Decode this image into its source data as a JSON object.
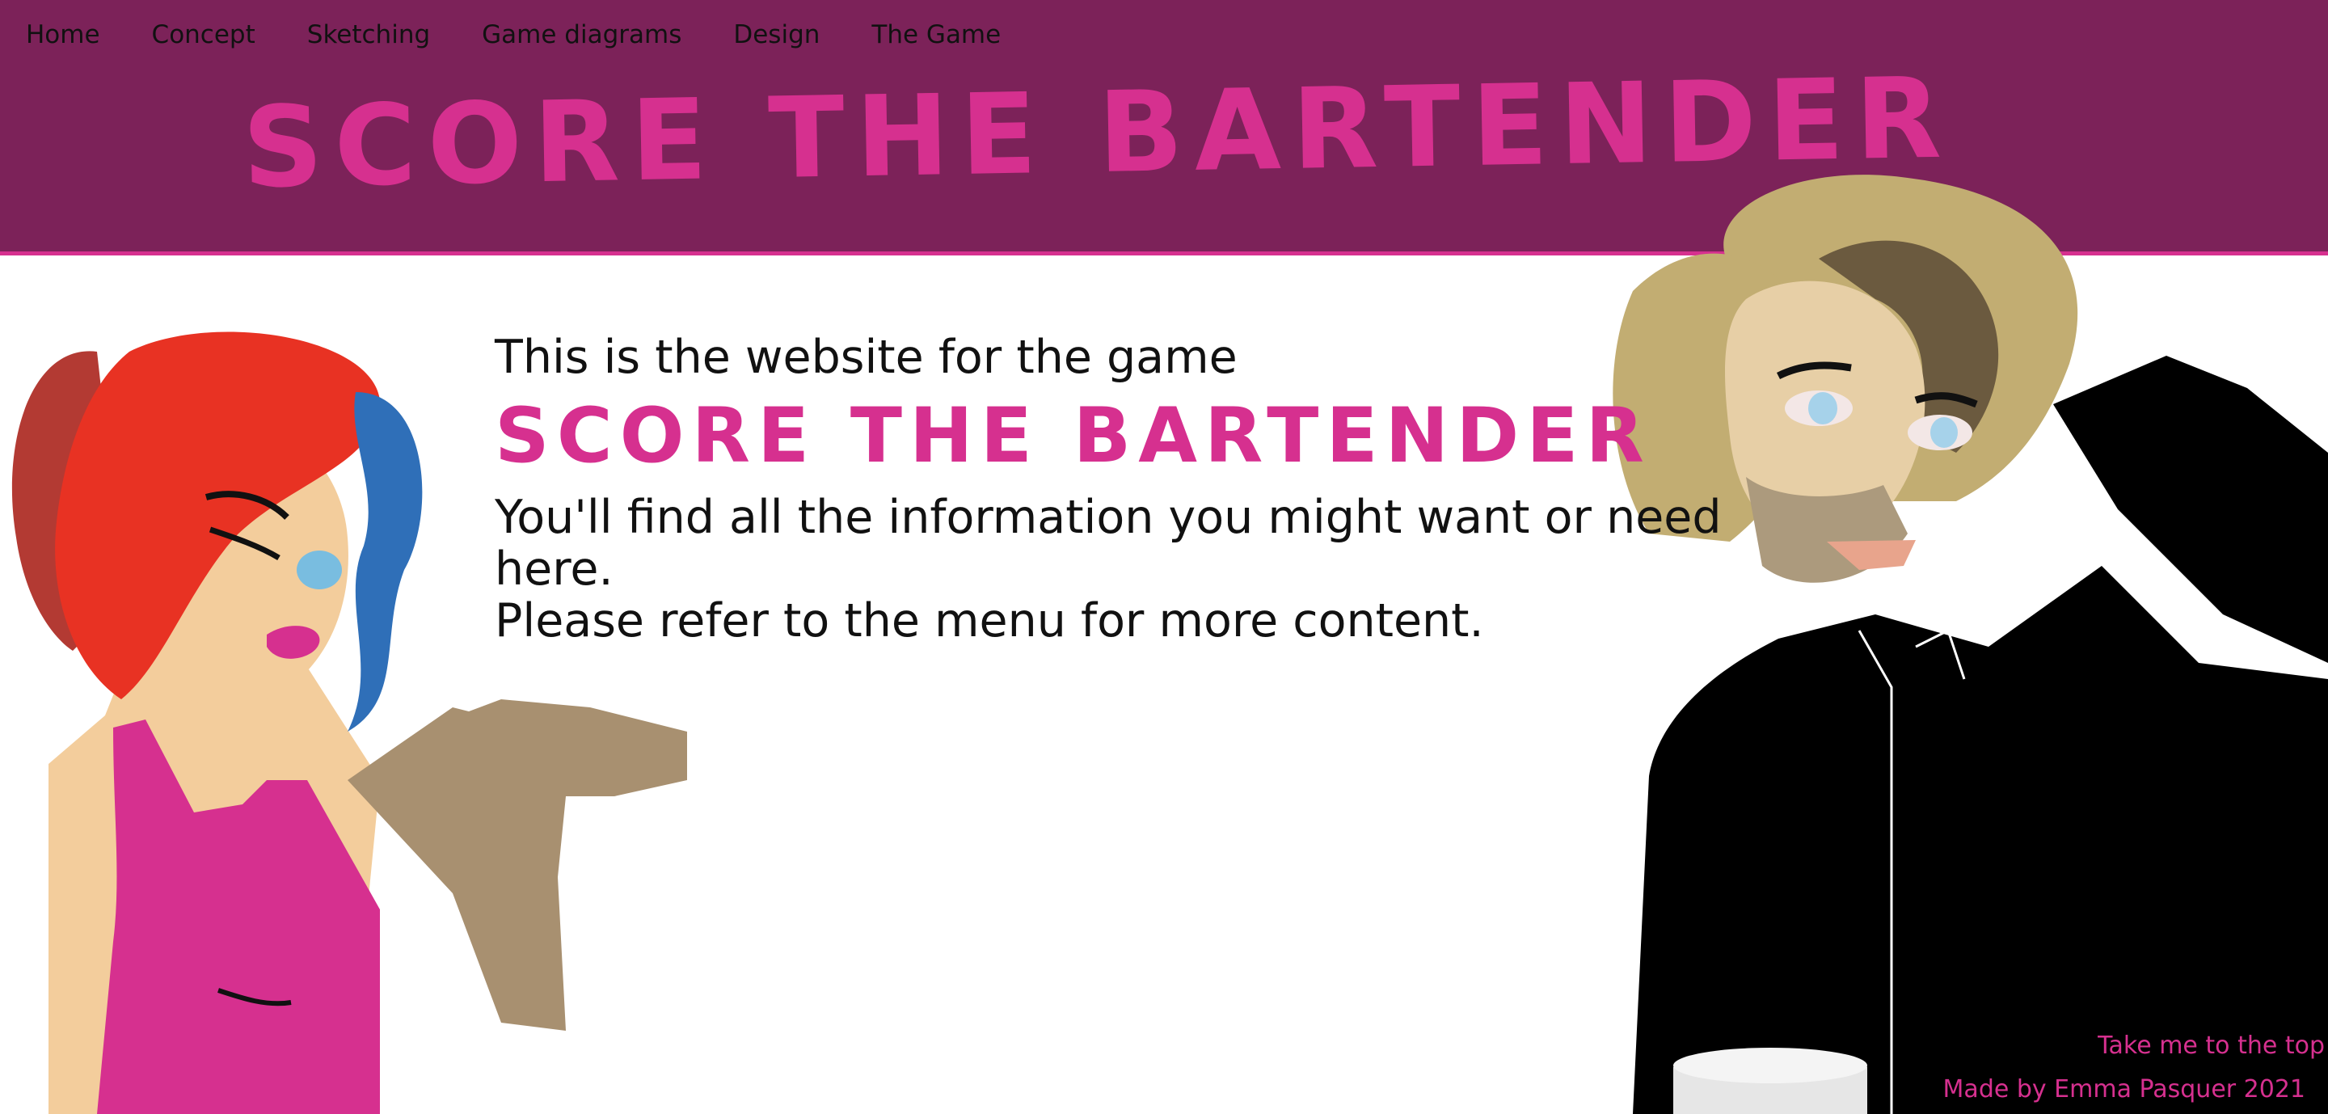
{
  "nav": {
    "items": [
      {
        "label": "Home"
      },
      {
        "label": "Concept"
      },
      {
        "label": "Sketching"
      },
      {
        "label": "Game diagrams"
      },
      {
        "label": "Design"
      },
      {
        "label": "The Game"
      }
    ]
  },
  "header": {
    "logo_text": "SCORE THE BARTENDER"
  },
  "main": {
    "intro_line1": "This is the website for the game",
    "logo_text": "SCORE THE BARTENDER",
    "intro_line2": "You'll find all the information you might want or need here.",
    "intro_line3": "Please refer to the menu for more content."
  },
  "footer": {
    "top_link": "Take me to the top",
    "credit": "Made by Emma Pasquer 2021"
  },
  "colors": {
    "header_bg": "#7c2259",
    "accent": "#d6308f",
    "text": "#111111"
  },
  "icons": {
    "left_character": "woman-character-illustration",
    "right_character": "bartender-character-illustration"
  }
}
